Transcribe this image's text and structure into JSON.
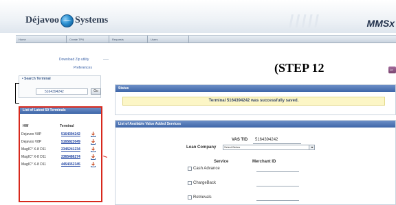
{
  "header": {
    "logo_part1": "Déjavoo",
    "logo_part2": "Systems",
    "brand_right": "MMSx"
  },
  "nav": {
    "items": [
      "Home",
      "Create TPN",
      "Requests",
      "Users"
    ]
  },
  "sidebar": {
    "download_zip": "Download Zip utility",
    "preferences": "Preferences",
    "search_title": "• Search Terminal",
    "search_value": "5164394242",
    "go_label": "Go",
    "list_title": "List of Latest 50 Terminals",
    "col_hw": "HW",
    "col_terminal": "Terminal",
    "rows": [
      {
        "hw": "Dejavoo V8P",
        "terminal": "5164394242"
      },
      {
        "hw": "Dejavoo V8P",
        "terminal": "5165823049"
      },
      {
        "hw": "MagIC* X-8 D11",
        "terminal": "2345241234"
      },
      {
        "hw": "MagIC* X-8 D11",
        "terminal": "2365486274"
      },
      {
        "hw": "MagIC* X-8 D11",
        "terminal": "4454352345"
      }
    ]
  },
  "step_label": "(STEP 12",
  "status": {
    "title": "Status",
    "message": "Terminal 5164394242 was successfully saved."
  },
  "vas": {
    "title": "List of Available Value Added Services",
    "tid_label": "VAS TID",
    "tid_value": "5164394242",
    "loan_label": "Loan Company",
    "loan_selected": "Select Below",
    "service_header": "Service",
    "merchant_header": "Merchant ID",
    "services": [
      "Cash Advance",
      "ChargeBack",
      "Retrievals"
    ]
  },
  "colors": {
    "accent_blue": "#3e66a8",
    "highlight_red": "#d8281c",
    "status_bg": "#fcf6c6"
  }
}
